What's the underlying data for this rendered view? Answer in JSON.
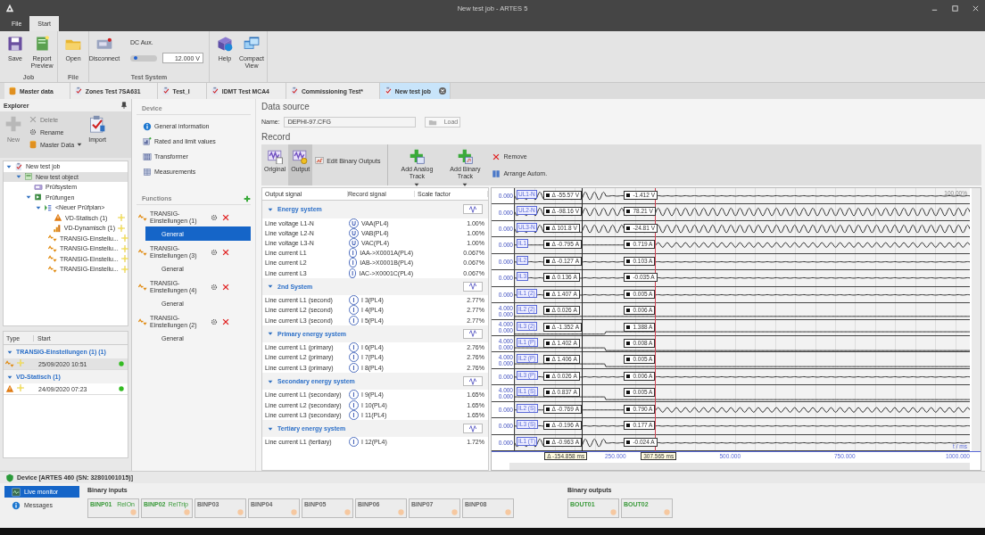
{
  "window": {
    "title": "New test job - ARTES 5"
  },
  "ribbon_tabs": [
    {
      "label": "File",
      "selected": false
    },
    {
      "label": "Start",
      "selected": true
    }
  ],
  "ribbon_groups": [
    {
      "label": "Job",
      "buttons": [
        {
          "label": "Save",
          "kind": "save"
        },
        {
          "label": "Report Preview",
          "kind": "report"
        }
      ]
    },
    {
      "label": "File",
      "buttons": [
        {
          "label": "Open",
          "kind": "open"
        }
      ]
    },
    {
      "label": "Test System",
      "buttons": [
        {
          "label": "Disconnect",
          "kind": "device"
        }
      ],
      "dc_aux": {
        "label": "DC Aux.",
        "level": 0.12,
        "value": "12.000 V"
      }
    },
    {
      "buttons": [
        {
          "label": "Help",
          "kind": "help"
        },
        {
          "label": "Compact View",
          "kind": "compact"
        }
      ]
    }
  ],
  "doc_tabs": [
    {
      "label": "Master data",
      "kind": "database",
      "selected": false
    },
    {
      "label": "Zones Test 7SA631",
      "kind": "job",
      "selected": false
    },
    {
      "label": "Test_I",
      "kind": "job",
      "selected": false
    },
    {
      "label": "IDMT Test MCA4",
      "kind": "job",
      "selected": false
    },
    {
      "label": "Commissioning Test*",
      "kind": "job",
      "selected": false
    },
    {
      "label": "New test job",
      "kind": "job",
      "selected": true
    }
  ],
  "explorer": {
    "title": "Explorer",
    "toolbar": [
      {
        "label": "New",
        "kind": "plus",
        "disabled": true
      },
      {
        "label": "Delete",
        "kind": "delete",
        "disabled": true
      },
      {
        "label": "Rename",
        "kind": "rename",
        "disabled": false
      },
      {
        "label": "Master Data",
        "kind": "database",
        "disabled": false
      },
      {
        "label": "Import",
        "kind": "import",
        "disabled": false
      }
    ],
    "tree": [
      {
        "label": "New test job",
        "kind": "job",
        "selected": false,
        "expanded": true,
        "children": [
          {
            "label": "New test object",
            "kind": "object",
            "selected": true,
            "expanded": true,
            "children": [
              {
                "label": "Prüfsystem",
                "kind": "system",
                "selected": false
              },
              {
                "label": "Prüfungen",
                "kind": "tests",
                "selected": false,
                "expanded": true,
                "children": [
                  {
                    "label": "<Neuer Prüfplan>",
                    "kind": "plan",
                    "selected": false,
                    "expanded": true,
                    "children": [
                      {
                        "label": "VD-Statisch (1)",
                        "kind": "static",
                        "selected": false
                      },
                      {
                        "label": "VD-Dynamisch (1)",
                        "kind": "dynamic",
                        "selected": false
                      },
                      {
                        "label": "TRANSIG-Einstellu...",
                        "kind": "transig",
                        "selected": false
                      },
                      {
                        "label": "TRANSIG-Einstellu...",
                        "kind": "transig",
                        "selected": false
                      },
                      {
                        "label": "TRANSIG-Einstellu...",
                        "kind": "transig",
                        "selected": false
                      },
                      {
                        "label": "TRANSIG-Einstellu...",
                        "kind": "transig",
                        "selected": false
                      }
                    ]
                  }
                ]
              }
            ]
          }
        ]
      }
    ],
    "results": {
      "columns": [
        "Type",
        "Start"
      ],
      "groups": [
        {
          "label": "TRANSIG-Einstellungen (1) (1)",
          "expanded": true,
          "rows": [
            {
              "kind": "transig",
              "start": "25/09/2020 10:51",
              "selected": true,
              "color": "#33bb22"
            }
          ]
        },
        {
          "label": "VD-Statisch (1)",
          "expanded": true,
          "rows": [
            {
              "kind": "static",
              "start": "24/09/2020 07:23",
              "selected": false,
              "color": "#33bb22"
            }
          ]
        }
      ]
    }
  },
  "device": {
    "title": "Device",
    "items": [
      {
        "label": "General information",
        "kind": "info"
      },
      {
        "label": "Rated and limit values",
        "kind": "rated"
      },
      {
        "label": "Transformer",
        "kind": "transformer"
      },
      {
        "label": "Measurements",
        "kind": "measure"
      }
    ]
  },
  "functions": {
    "title": "Functions",
    "items": [
      {
        "label": "TRANSIG-Einstellungen (1)",
        "sub": {
          "label": "General",
          "selected": true
        }
      },
      {
        "label": "TRANSIG-Einstellungen (3)",
        "sub": {
          "label": "General",
          "selected": false
        }
      },
      {
        "label": "TRANSIG-Einstellungen (4)",
        "sub": {
          "label": "General",
          "selected": false
        }
      },
      {
        "label": "TRANSIG-Einstellungen (2)",
        "sub": {
          "label": "General",
          "selected": false
        }
      }
    ]
  },
  "data_source": {
    "title": "Data source",
    "name_label": "Name:",
    "name_value": "DEPHI-97.CFG",
    "load": {
      "label": "Load",
      "disabled": true
    }
  },
  "record": {
    "title": "Record",
    "toolbar": [
      {
        "label": "Original",
        "kind": "original",
        "selected": false
      },
      {
        "label": "Output",
        "kind": "output",
        "selected": true
      },
      {
        "label": "Edit Binary Outputs",
        "kind": "edit"
      },
      {
        "label": "Add Analog Track",
        "kind": "add_analog"
      },
      {
        "label": "Add Binary Track",
        "kind": "add_binary"
      },
      {
        "label": "Remove",
        "kind": "remove"
      },
      {
        "label": "Arrange Autom.",
        "kind": "arrange"
      }
    ],
    "columns": [
      "Output signal",
      "Record signal",
      "Scale factor"
    ],
    "groups": [
      {
        "label": "Energy system",
        "expanded": true,
        "rows": [
          {
            "output": "Line voltage L1-N",
            "type": "U",
            "record": "VAA(PL4)",
            "scale": "1.00%"
          },
          {
            "output": "Line voltage L2-N",
            "type": "U",
            "record": "VAB(PL4)",
            "scale": "1.00%"
          },
          {
            "output": "Line voltage L3-N",
            "type": "U",
            "record": "VAC(PL4)",
            "scale": "1.00%"
          },
          {
            "output": "Line current L1",
            "type": "I",
            "record": "IAA->X0001A(PL4)",
            "scale": "0.067%"
          },
          {
            "output": "Line current L2",
            "type": "I",
            "record": "IAB->X0001B(PL4)",
            "scale": "0.067%"
          },
          {
            "output": "Line current L3",
            "type": "I",
            "record": "IAC->X0001C(PL4)",
            "scale": "0.067%"
          }
        ]
      },
      {
        "label": "2nd System",
        "expanded": true,
        "rows": [
          {
            "output": "Line current L1 (second)",
            "type": "I",
            "record": "I 3(PL4)",
            "scale": "2.77%"
          },
          {
            "output": "Line current L2 (second)",
            "type": "I",
            "record": "I 4(PL4)",
            "scale": "2.77%"
          },
          {
            "output": "Line current L3 (second)",
            "type": "I",
            "record": "I 5(PL4)",
            "scale": "2.77%"
          }
        ]
      },
      {
        "label": "Primary energy system",
        "expanded": true,
        "rows": [
          {
            "output": "Line current L1 (primary)",
            "type": "I",
            "record": "I 6(PL4)",
            "scale": "2.76%"
          },
          {
            "output": "Line current L2 (primary)",
            "type": "I",
            "record": "I 7(PL4)",
            "scale": "2.76%"
          },
          {
            "output": "Line current L3 (primary)",
            "type": "I",
            "record": "I 8(PL4)",
            "scale": "2.76%"
          }
        ]
      },
      {
        "label": "Secondary energy system",
        "expanded": true,
        "rows": [
          {
            "output": "Line current L1 (secondary)",
            "type": "I",
            "record": "I 9(PL4)",
            "scale": "1.65%"
          },
          {
            "output": "Line current L2 (secondary)",
            "type": "I",
            "record": "I 10(PL4)",
            "scale": "1.65%"
          },
          {
            "output": "Line current L3 (secondary)",
            "type": "I",
            "record": "I 11(PL4)",
            "scale": "1.65%"
          }
        ]
      },
      {
        "label": "Tertiary energy system",
        "expanded": true,
        "rows": [
          {
            "output": "Line current L1 (tertiary)",
            "type": "I",
            "record": "I 12(PL4)",
            "scale": "1.72%"
          }
        ]
      }
    ],
    "traces": {
      "zoom": "100.00%",
      "unit": "t / ms",
      "cursor_delta": "Δ -154.858 ms",
      "cursor_time": "307.565 ms",
      "ticks": [
        "250.000",
        "500.000",
        "750.000",
        "1000.000"
      ],
      "tracks": [
        {
          "label": "UL1-N",
          "scale": [
            "0.000"
          ],
          "delta": "Δ -55.57 V",
          "value": "-1.412 V",
          "kind": "burst"
        },
        {
          "label": "UL2-N",
          "scale": [
            "0.000"
          ],
          "delta": "Δ -98.16 V",
          "value": "78.21 V",
          "kind": "sine"
        },
        {
          "label": "UL3-N",
          "scale": [
            "0.000"
          ],
          "delta": "Δ 101.8 V",
          "value": "-24.81 V",
          "kind": "sine"
        },
        {
          "label": "IL1",
          "scale": [
            "0.000"
          ],
          "delta": "Δ -0.795 A",
          "value": "0.719 A",
          "kind": "late_sine"
        },
        {
          "label": "IL2",
          "scale": [
            "0.000"
          ],
          "delta": "Δ -0.127 A",
          "value": "0.103 A",
          "kind": "flat"
        },
        {
          "label": "IL3",
          "scale": [
            "0.000"
          ],
          "delta": "Δ 0.136 A",
          "value": "-0.035 A",
          "kind": "flat"
        },
        {
          "label": "IL1 (2)",
          "scale": [
            "0.000"
          ],
          "delta": "Δ 1.407 A",
          "value": "0.005 A",
          "kind": "flat"
        },
        {
          "label": "IL2 (2)",
          "scale": [
            "4.000",
            "0.000"
          ],
          "delta": "Δ 0.026 A",
          "value": "0.006 A",
          "kind": "low"
        },
        {
          "label": "IL3 (2)",
          "scale": [
            "4.000",
            "0.000"
          ],
          "delta": "Δ -1.352 A",
          "value": "1.388 A",
          "kind": "step_up"
        },
        {
          "label": "IL1 (P)",
          "scale": [
            "4.000",
            "0.000"
          ],
          "delta": "Δ 1.402 A",
          "value": "0.008 A",
          "kind": "step_down"
        },
        {
          "label": "IL2 (P)",
          "scale": [
            "4.000",
            "0.000"
          ],
          "delta": "Δ 1.406 A",
          "value": "0.005 A",
          "kind": "step_down"
        },
        {
          "label": "IL3 (P)",
          "scale": [
            "0.000"
          ],
          "delta": "Δ 0.026 A",
          "value": "0.006 A",
          "kind": "flat"
        },
        {
          "label": "IL1 (S)",
          "scale": [
            "4.000",
            "0.000"
          ],
          "delta": "Δ 0.837 A",
          "value": "0.005 A",
          "kind": "step_down"
        },
        {
          "label": "IL2 (S)",
          "scale": [
            "0.000"
          ],
          "delta": "Δ -0.769 A",
          "value": "0.790 A",
          "kind": "late_sine"
        },
        {
          "label": "IL3 (S)",
          "scale": [
            "0.000"
          ],
          "delta": "Δ -0.196 A",
          "value": "0.177 A",
          "kind": "flat"
        },
        {
          "label": "IL1 (T)",
          "scale": [
            "0.000"
          ],
          "delta": "Δ -0.963 A",
          "value": "-0.024 A",
          "kind": "burst"
        }
      ]
    }
  },
  "device_panel": {
    "title": "Device [ARTES 460 (SN: 32801001015)]",
    "nav": [
      {
        "label": "Live monitor",
        "kind": "monitor",
        "selected": true
      },
      {
        "label": "Messages",
        "kind": "info",
        "selected": false
      }
    ],
    "inputs": {
      "title": "Binary inputs",
      "items": [
        {
          "label": "BINP01",
          "tag": "RelOn",
          "active": true
        },
        {
          "label": "BINP02",
          "tag": "RelTrip",
          "active": true
        },
        {
          "label": "BINP03",
          "active": false
        },
        {
          "label": "BINP04",
          "active": false
        },
        {
          "label": "BINP05",
          "active": false
        },
        {
          "label": "BINP06",
          "active": false
        },
        {
          "label": "BINP07",
          "active": false
        },
        {
          "label": "BINP08",
          "active": false
        }
      ]
    },
    "outputs": {
      "title": "Binary outputs",
      "items": [
        {
          "label": "BOUT01",
          "active": true
        },
        {
          "label": "BOUT02",
          "active": true
        }
      ]
    }
  }
}
